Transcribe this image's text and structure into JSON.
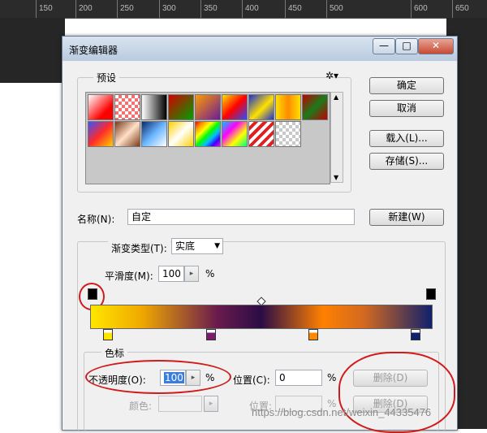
{
  "ruler": {
    "ticks": [
      "150",
      "200",
      "250",
      "300",
      "350",
      "400",
      "450",
      "500",
      "600",
      "650"
    ]
  },
  "dialog": {
    "title": "渐变编辑器",
    "window_buttons": {
      "minimize": "—",
      "maximize": "□",
      "close": "✕"
    }
  },
  "presets": {
    "label": "预设",
    "gear_icon": "gear-icon",
    "swatches": [
      {
        "bg": "linear-gradient(135deg,#ffffff,#ff0000 70%)"
      },
      {
        "bg": "repeating-conic-gradient(#ff6b6b 0 25%,#fff 0 50%) 0 0/8px 8px"
      },
      {
        "bg": "linear-gradient(to right,#ffffff,#000000)"
      },
      {
        "bg": "linear-gradient(135deg,#d10000,#00a000)"
      },
      {
        "bg": "linear-gradient(135deg,#ff9a00,#6a1b9a)"
      },
      {
        "bg": "linear-gradient(135deg,#ffe100,#ff0000,#2a4dff)"
      },
      {
        "bg": "linear-gradient(135deg,#1c2fd6,#ffe100 55%,#1c2fd6)"
      },
      {
        "bg": "linear-gradient(to right,#ffe000,#ff8a00,#ffe000)"
      },
      {
        "bg": "linear-gradient(135deg,#c00000,#1b7a1b,#c00000)"
      },
      {
        "bg": "linear-gradient(135deg,#3a52ff,#ff2a2a 50%,#ffd000)"
      },
      {
        "bg": "linear-gradient(135deg,#7a3b1b,#ffe0c8,#7a3b1b)"
      },
      {
        "bg": "linear-gradient(135deg,#0a2a6e,#6bb7ff,#ffffff)"
      },
      {
        "bg": "linear-gradient(135deg,#ffd000,#ffffff,#ffd000)"
      },
      {
        "bg": "linear-gradient(135deg,#ff0000,#ff9900,#ffff00,#00ff00,#00c0ff,#3b00ff,#ff00ff)"
      },
      {
        "bg": "linear-gradient(135deg,#00c8ff,#ff00ff,#ffff00,#00ff80)"
      },
      {
        "bg": "repeating-linear-gradient(135deg,#ffffff 0 4px,#e02020 4px 8px)"
      },
      {
        "bg": "repeating-conic-gradient(#c8c8c8 0 25%,#fff 0 50%) 0 0/8px 8px"
      }
    ]
  },
  "buttons": {
    "ok": "确定",
    "cancel": "取消",
    "load": "载入(L)...",
    "save": "存储(S)...",
    "new": "新建(W)",
    "delete_opacity": "删除(D)",
    "delete_color": "删除(D)"
  },
  "name": {
    "label": "名称(N):",
    "value": "自定"
  },
  "gradient": {
    "type_label": "渐变类型(T):",
    "type_value": "实底",
    "smoothness_label": "平滑度(M):",
    "smoothness_value": "100",
    "smoothness_unit": "%",
    "color_stops": [
      "#ffe600",
      "#7a1b6e",
      "#ff8a00",
      "#10206c"
    ]
  },
  "stops": {
    "group_label": "色标",
    "opacity_label": "不透明度(O):",
    "opacity_value": "100",
    "opacity_unit": "%",
    "position_label": "位置(C):",
    "position_value": "0",
    "position_unit": "%",
    "color_label": "颜色:",
    "color_position_label": "位置:",
    "color_position_unit": "%"
  },
  "watermark": "https://blog.csdn.net/weixin_44335476"
}
